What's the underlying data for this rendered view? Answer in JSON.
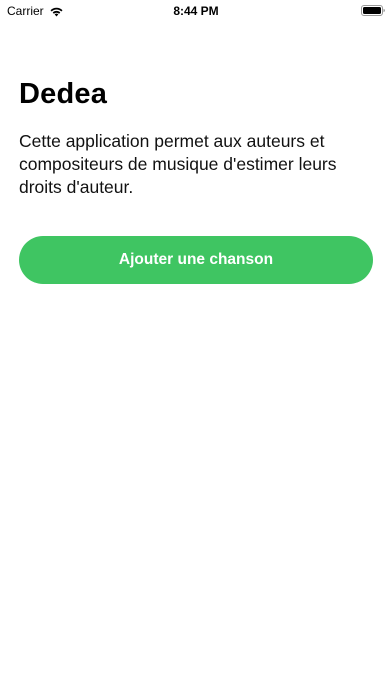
{
  "status_bar": {
    "carrier": "Carrier",
    "time": "8:44 PM",
    "icons": [
      "wifi-icon",
      "battery-icon"
    ]
  },
  "main": {
    "title": "Dedea",
    "description": "Cette application permet aux auteurs et compositeurs de musique d'estimer leurs droits d'auteur.",
    "add_song_button_label": "Ajouter une chanson"
  },
  "colors": {
    "accent_green": "#3fc562",
    "background": "#ffffff",
    "text": "#000000"
  }
}
